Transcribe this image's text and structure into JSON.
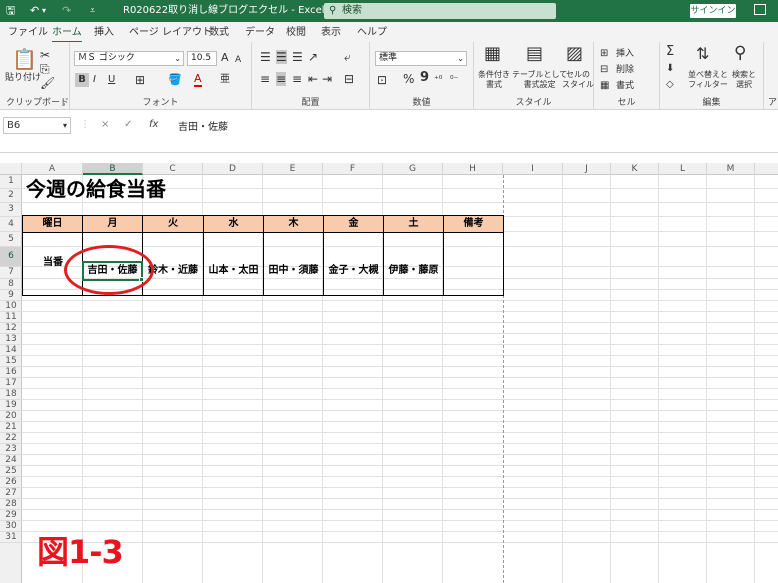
{
  "app": {
    "title": "R020622取り消し線ブログエクセル  -  Excel",
    "search_placeholder": "検索",
    "signin_label": "サインイン"
  },
  "ribbon_tabs": [
    "ファイル",
    "ホーム",
    "挿入",
    "ページ レイアウト",
    "数式",
    "データ",
    "校閲",
    "表示",
    "ヘルプ"
  ],
  "ribbon": {
    "clipboard": {
      "paste_label": "貼り付け",
      "group_label": "クリップボード"
    },
    "font": {
      "font_name": "ＭＳ ゴシック",
      "font_size": "10.5",
      "group_label": "フォント",
      "bold": "B",
      "italic": "I",
      "underline": "U",
      "grow": "A",
      "shrink": "A",
      "font_color": "A",
      "phonetic": "亜"
    },
    "alignment": {
      "group_label": "配置"
    },
    "number": {
      "format": "標準",
      "group_label": "数値",
      "percent": "%",
      "comma": "9"
    },
    "styles": {
      "conditional": "条件付き\n書式",
      "table": "テーブルとして\n書式設定",
      "cell_style": "セルの\nスタイル",
      "group_label": "スタイル"
    },
    "cells": {
      "insert": "挿入",
      "delete": "削除",
      "format": "書式",
      "group_label": "セル"
    },
    "editing": {
      "sort": "並べ替えと\nフィルター",
      "find": "検索と\n選択",
      "group_label": "編集",
      "sum": "Σ"
    },
    "next_group_label": "ア"
  },
  "formula_bar": {
    "name_box": "B6",
    "content": "吉田・佐藤",
    "fx": "fx",
    "cancel": "×",
    "enter": "✓"
  },
  "columns": [
    "A",
    "B",
    "C",
    "D",
    "E",
    "F",
    "G",
    "H",
    "I",
    "J",
    "K",
    "L",
    "M"
  ],
  "selected_column": "B",
  "selected_row": 6,
  "rows": [
    "1",
    "2",
    "3",
    "4",
    "5",
    "6",
    "7",
    "8",
    "9",
    "10",
    "11",
    "12",
    "13",
    "14",
    "15",
    "16",
    "17",
    "18",
    "19",
    "20",
    "21",
    "22",
    "23",
    "24",
    "25",
    "26",
    "27",
    "28",
    "29",
    "30",
    "31"
  ],
  "sheet": {
    "title": "今週の給食当番",
    "header_row": [
      "曜日",
      "月",
      "火",
      "水",
      "木",
      "金",
      "土",
      "備考"
    ],
    "duty_label": "当番",
    "duty_row": [
      "吉田・佐藤",
      "鈴木・近藤",
      "山本・太田",
      "田中・須藤",
      "金子・大槻",
      "伊藤・藤原",
      ""
    ]
  },
  "annotation": {
    "figure_label": "図1-3",
    "circle_color": "#e02020",
    "label_color": "#e8141e"
  },
  "colors": {
    "excel_green": "#217346",
    "header_fill": "#f8cbad"
  }
}
